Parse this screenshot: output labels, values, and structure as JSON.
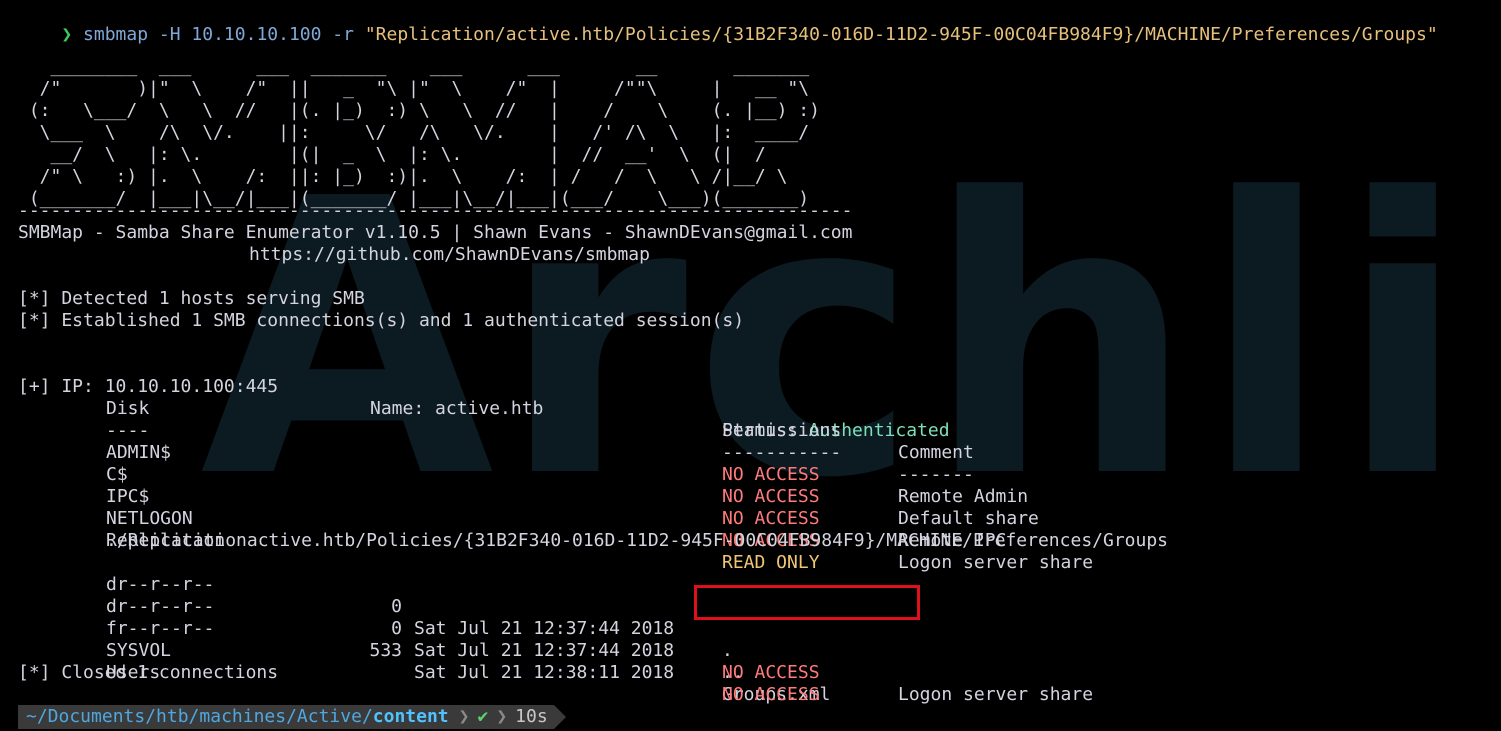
{
  "command": {
    "prompt_glyph": "❯",
    "program": "smbmap -H 10.10.10.100 -r ",
    "argument": "\"Replication/active.htb/Policies/{31B2F340-016D-11D2-945F-00C04FB984F9}/MACHINE/Preferences/Groups\""
  },
  "banner": {
    "ascii_art": "   ________  ___      ___  _______    ___      ___       __       _______\n  /\"       )|\"  \\    /\"  ||   _  \"\\ |\"  \\    /\"  |     /\"\"\\     |   __ \"\\\n (:   \\___/  \\   \\  //   |(. |_)  :) \\   \\  //   |    /    \\    (. |__) :)\n  \\___  \\    /\\  \\/.    ||:     \\/   /\\   \\/.    |   /' /\\  \\   |:  ____/\n   __/  \\   |: \\.        |(|  _  \\  |: \\.        |  //  __'  \\  (|  /\n  /\" \\   :) |.  \\    /:  ||: |_)  :)|.  \\    /:  | /   /  \\   \\ /|__/ \\\n (_______/  |___|\\__/|___|(_______/ |___|\\__/|___|(___/    \\___)(_______)",
    "divider": "-----------------------------------------------------------------------------",
    "title_line": "SMBMap - Samba Share Enumerator v1.10.5 | Shawn Evans - ShawnDEvans@gmail.com",
    "url_line": "https://github.com/ShawnDEvans/smbmap"
  },
  "info": [
    "[*] Detected 1 hosts serving SMB",
    "[*] Established 1 SMB connections(s) and 1 authenticated session(s)"
  ],
  "host": {
    "ip_label": "[+] IP: 10.10.10.100:445",
    "name_label": "Name: active.htb",
    "status_prefix": "Status: ",
    "status_value": "Authenticated"
  },
  "table": {
    "headers": [
      "Disk",
      "Permissions",
      "Comment"
    ],
    "underlines": [
      "----",
      "-----------",
      "-------"
    ],
    "shares": [
      {
        "disk": "ADMIN$",
        "perm": "NO ACCESS",
        "comment": "Remote Admin"
      },
      {
        "disk": "C$",
        "perm": "NO ACCESS",
        "comment": "Default share"
      },
      {
        "disk": "IPC$",
        "perm": "NO ACCESS",
        "comment": "Remote IPC"
      },
      {
        "disk": "NETLOGON",
        "perm": "NO ACCESS",
        "comment": "Logon server share"
      },
      {
        "disk": "Replication",
        "perm": "READ ONLY",
        "comment": ""
      }
    ],
    "listing_path": "./Replicationactive.htb/Policies/{31B2F340-016D-11D2-945F-00C04FB984F9}/MACHINE/Preferences/Groups",
    "files": [
      {
        "mode": "dr--r--r--",
        "size": "0",
        "date": "Sat Jul 21 12:37:44 2018",
        "name": "."
      },
      {
        "mode": "dr--r--r--",
        "size": "0",
        "date": "Sat Jul 21 12:37:44 2018",
        "name": ".."
      },
      {
        "mode": "fr--r--r--",
        "size": "533",
        "date": "Sat Jul 21 12:38:11 2018",
        "name": "Groups.xml"
      }
    ],
    "shares_after": [
      {
        "disk": "SYSVOL",
        "perm": "NO ACCESS",
        "comment": "Logon server share"
      },
      {
        "disk": "Users",
        "perm": "NO ACCESS",
        "comment": ""
      }
    ]
  },
  "closing": "[*] Closed 1 connections",
  "statusbar": {
    "path_prefix": "~/Documents/htb/machines/Active/",
    "path_current": "content",
    "check": "✔",
    "duration": "10s"
  },
  "colors": {
    "background": "#000000",
    "highlight_box": "#e0101a",
    "no_access": "#ff7b7b",
    "read_only": "#f0c674",
    "authenticated": "#7ee0b8"
  }
}
